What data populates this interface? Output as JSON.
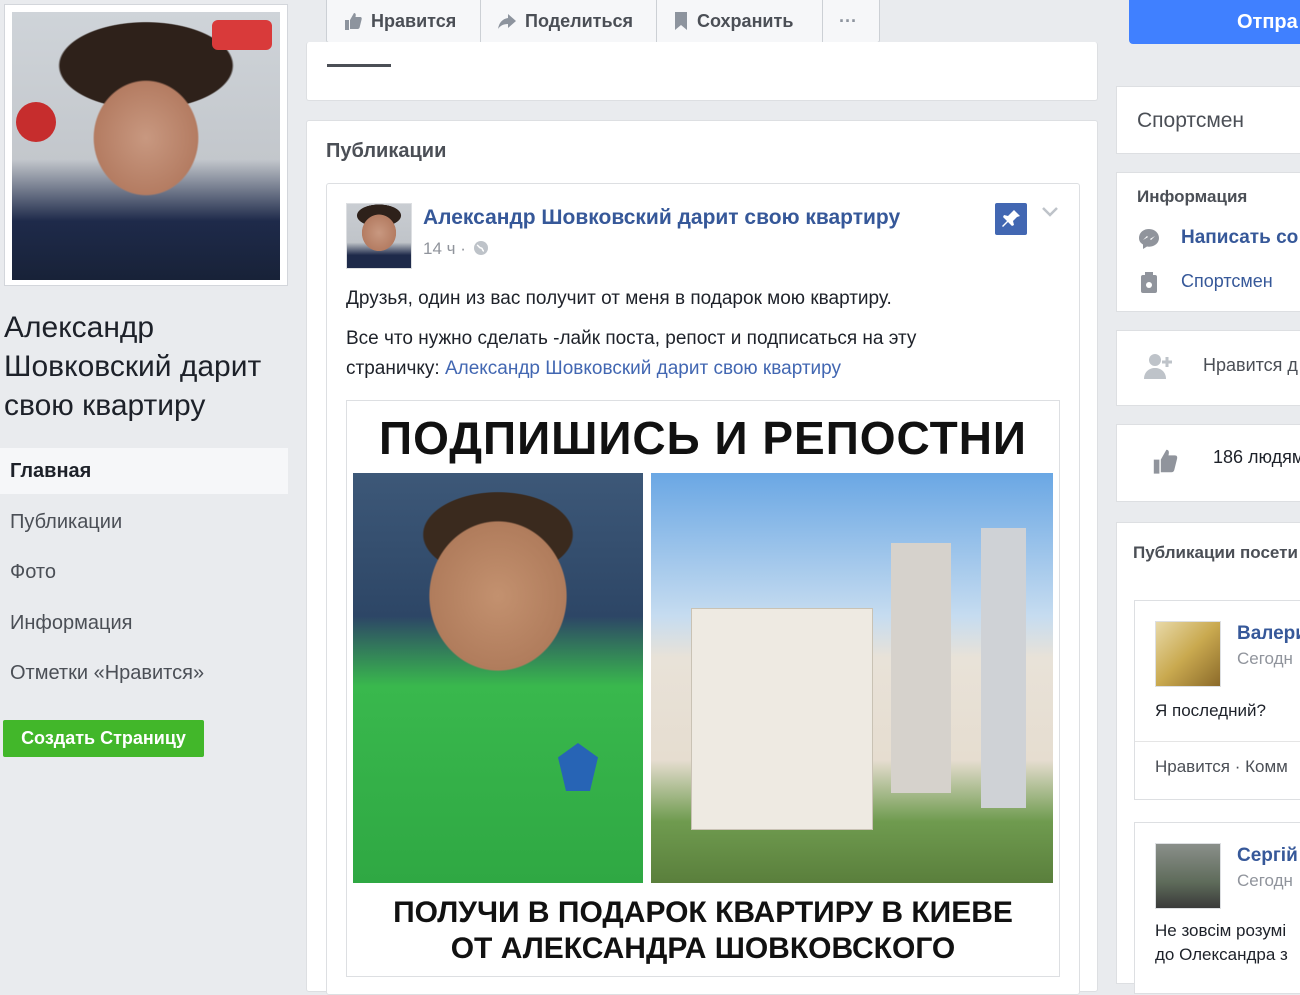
{
  "left": {
    "page_name": "Александр Шовковский дарит свою квартиру",
    "nav": [
      {
        "label": "Главная"
      },
      {
        "label": "Публикации"
      },
      {
        "label": "Фото"
      },
      {
        "label": "Информация"
      },
      {
        "label": "Отметки «Нравится»"
      }
    ],
    "create_page": "Создать Страницу"
  },
  "actionbar": {
    "like": "Нравится",
    "share": "Поделиться",
    "save": "Сохранить",
    "more": "···"
  },
  "send_button": "Отпра",
  "main": {
    "section_title": "Публикации",
    "post": {
      "author": "Александр Шовковский дарит свою квартиру",
      "time": "14 ч ·",
      "text1": "Друзья, один из вас получит от меня в подарок мою квартиру.",
      "text2_line1": "Все что нужно сделать -лайк поста, репост и подписаться на эту",
      "text2_line2_prefix": "страничку: ",
      "text2_link": "Александр Шовковский дарит свою квартиру",
      "poster_top": "ПОДПИШИСЬ И РЕПОСТНИ",
      "poster_bottom_line1": "ПОЛУЧИ В ПОДАРОК КВАРТИРУ В КИЕВЕ",
      "poster_bottom_line2": "ОТ АЛЕКСАНДРА ШОВКОВСКОГО"
    }
  },
  "right": {
    "category": "Спортсмен",
    "info_title": "Информация",
    "write": "Написать со",
    "athlete": "Спортсмен",
    "likes_invite": "Нравится д",
    "likes_count": "186 людям",
    "visitor_posts_title": "Публикации посети",
    "visitor1": {
      "name": "Валери",
      "time": "Сегодн",
      "text": "Я последний?",
      "actions": "Нравится · Комм"
    },
    "visitor2": {
      "name": "Сергій",
      "time": "Сегодн",
      "text1": "Не зовсім розумі",
      "text2": "до Олександра з"
    }
  },
  "colors": {
    "link": "#365899",
    "green": "#42b72a",
    "blue": "#4080ff",
    "pin": "#4267b2"
  }
}
